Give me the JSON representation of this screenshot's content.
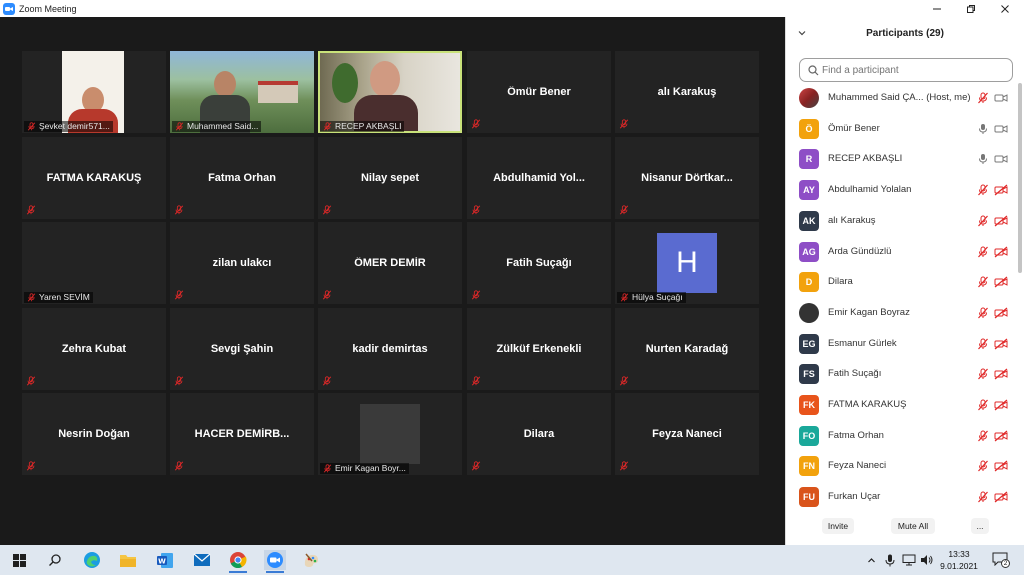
{
  "window": {
    "title": "Zoom Meeting"
  },
  "gallery": {
    "tiles": [
      {
        "name": "",
        "label": "Şevket demir571..."
      },
      {
        "name": "",
        "label": "Muhammed Said..."
      },
      {
        "name": "",
        "label": "RECEP AKBAŞLI"
      },
      {
        "name": "Ömür Bener",
        "label": ""
      },
      {
        "name": "alı  Karakuş",
        "label": ""
      },
      {
        "name": "FATMA KARAKUŞ",
        "label": ""
      },
      {
        "name": "Fatma Orhan",
        "label": ""
      },
      {
        "name": "Nilay sepet",
        "label": ""
      },
      {
        "name": "Abdulhamid  Yol...",
        "label": ""
      },
      {
        "name": "Nisanur  Dörtkar...",
        "label": ""
      },
      {
        "name": "",
        "label": "Yaren SEVİM"
      },
      {
        "name": "zilan ulakcı",
        "label": ""
      },
      {
        "name": "ÖMER DEMİR",
        "label": ""
      },
      {
        "name": "Fatih Suçağı",
        "label": ""
      },
      {
        "name": "",
        "label": "Hülya Suçağı",
        "avatar": "H"
      },
      {
        "name": "Zehra Kubat",
        "label": ""
      },
      {
        "name": "Sevgi Şahin",
        "label": ""
      },
      {
        "name": "kadir demirtas",
        "label": ""
      },
      {
        "name": "Zülküf Erkenekli",
        "label": ""
      },
      {
        "name": "Nurten Karadağ",
        "label": ""
      },
      {
        "name": "Nesrin Doğan",
        "label": ""
      },
      {
        "name": "HACER   DEMİRB...",
        "label": ""
      },
      {
        "name": "",
        "label": "Emir Kagan Boyr..."
      },
      {
        "name": "Dilara",
        "label": ""
      },
      {
        "name": "Feyza Naneci",
        "label": ""
      }
    ]
  },
  "participants": {
    "title": "Participants (29)",
    "search_placeholder": "Find a participant",
    "list": [
      {
        "initials": "",
        "name": "Muhammed Said ÇA...  (Host, me)",
        "color": "#b23a3a",
        "mic": "muted",
        "cam": "on"
      },
      {
        "initials": "Ö",
        "name": "Ömür Bener",
        "color": "#f2a20d",
        "mic": "on",
        "cam": "on"
      },
      {
        "initials": "R",
        "name": "RECEP AKBAŞLI",
        "color": "#8e4ec6",
        "mic": "on",
        "cam": "on"
      },
      {
        "initials": "AY",
        "name": "Abdulhamid Yolalan",
        "color": "#8e4ec6",
        "mic": "muted",
        "cam": "off"
      },
      {
        "initials": "AK",
        "name": "alı  Karakuş",
        "color": "#2f3a4a",
        "mic": "muted",
        "cam": "off"
      },
      {
        "initials": "AG",
        "name": "Arda Gündüzlü",
        "color": "#8e4ec6",
        "mic": "muted",
        "cam": "off"
      },
      {
        "initials": "D",
        "name": "Dilara",
        "color": "#f2a20d",
        "mic": "muted",
        "cam": "off"
      },
      {
        "initials": "",
        "name": "Emir Kagan Boyraz",
        "color": "#333333",
        "mic": "muted",
        "cam": "off"
      },
      {
        "initials": "EG",
        "name": "Esmanur Gürlek",
        "color": "#2f3a4a",
        "mic": "muted",
        "cam": "off"
      },
      {
        "initials": "FS",
        "name": "Fatih Suçağı",
        "color": "#2f3a4a",
        "mic": "muted",
        "cam": "off"
      },
      {
        "initials": "FK",
        "name": "FATMA KARAKUŞ",
        "color": "#e8541b",
        "mic": "muted",
        "cam": "off"
      },
      {
        "initials": "FO",
        "name": "Fatma Orhan",
        "color": "#1aa89a",
        "mic": "muted",
        "cam": "off"
      },
      {
        "initials": "FN",
        "name": "Feyza Naneci",
        "color": "#f2a20d",
        "mic": "muted",
        "cam": "off"
      },
      {
        "initials": "FU",
        "name": "Furkan Uçar",
        "color": "#d9541b",
        "mic": "muted",
        "cam": "off"
      }
    ],
    "invite_label": "Invite",
    "mute_all_label": "Mute All",
    "more_label": "..."
  },
  "taskbar": {
    "time": "13:33",
    "date": "9.01.2021",
    "notification_count": "2"
  },
  "colors": {
    "accent": "#2d8cff",
    "active_speaker": "#c9e27a",
    "muted_red": "#e02828"
  }
}
